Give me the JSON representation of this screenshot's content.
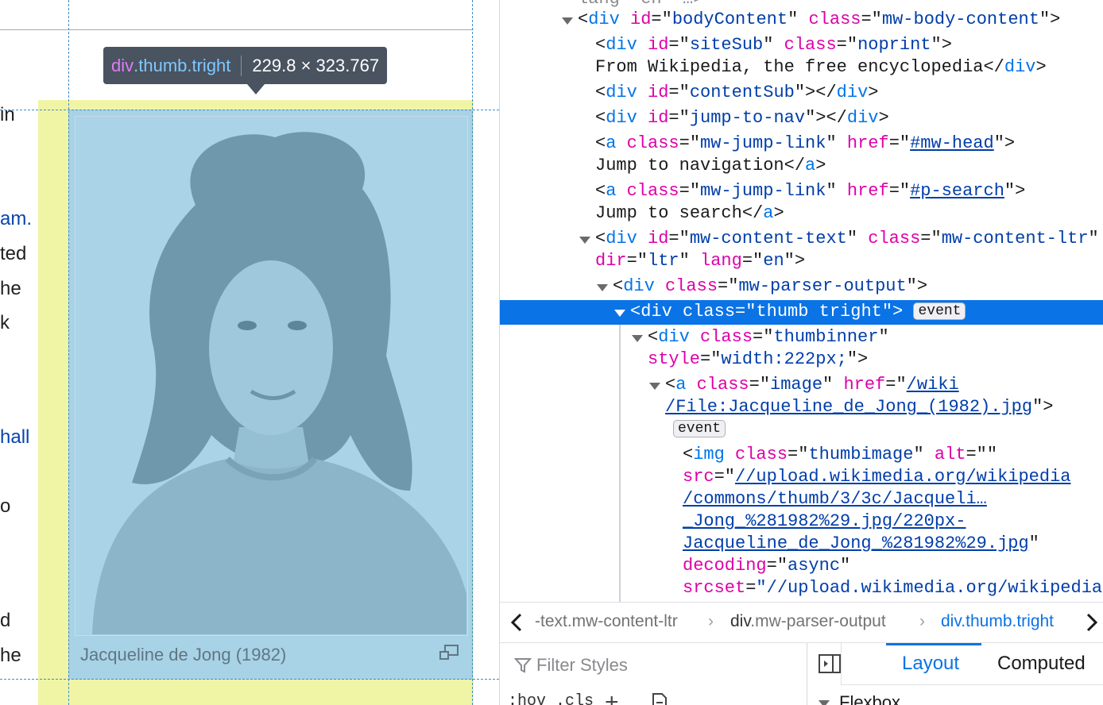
{
  "page": {
    "fragments": [
      {
        "text": "in",
        "link": false
      },
      {
        "text": "am.",
        "link": true
      },
      {
        "text": "ted",
        "link": false
      },
      {
        "text": "he",
        "link": false
      },
      {
        "text": "k",
        "link": false
      },
      {
        "text": "hall",
        "link": true
      },
      {
        "text": "o",
        "link": false
      },
      {
        "text": "d",
        "link": false
      },
      {
        "text": "he",
        "link": false
      }
    ],
    "caption": "Jacqueline de Jong (1982)",
    "highlight_colors": {
      "margin": "#f0f5a6",
      "content": "#a8d2e6"
    }
  },
  "tooltip": {
    "tag": "div",
    "classes": ".thumb.tright",
    "dimensions": "229.8 × 323.767"
  },
  "markup": {
    "top_partial": "lang=\"en\" …>",
    "lines": {
      "l1_tag": "div",
      "l1_id": "bodyContent",
      "l1_class": "mw-body-content",
      "l2_tag": "div",
      "l2_id": "siteSub",
      "l2_class": "noprint",
      "l2_text": "From Wikipedia, the free encyclopedia",
      "l3_id": "contentSub",
      "l4_id": "jump-to-nav",
      "l5_class": "mw-jump-link",
      "l5_href": "#mw-head",
      "l5_text": "Jump to navigation",
      "l6_class": "mw-jump-link",
      "l6_href": "#p-search",
      "l6_text": "Jump to search",
      "l7_id": "mw-content-text",
      "l7_class": "mw-content-ltr",
      "l7_dir": "ltr",
      "l7_lang": "en",
      "l8_class": "mw-parser-output",
      "l9_text": "<div class=\"thumb tright\">",
      "l9_badge": "event",
      "l10_class": "thumbinner",
      "l10_style": "width:222px;",
      "l11_class": "image",
      "l11_href_1": "/wiki",
      "l11_href_2": "/File:Jacqueline_de_Jong_(1982).jpg",
      "l11_badge": "event",
      "l12_class": "thumbimage",
      "l12_alt": "",
      "l12_src_1": "//upload.wikimedia.org/wikipedia",
      "l12_src_2": "/commons/thumb/3/3c/Jacqueli…",
      "l12_src_3": "_Jong_%281982%29.jpg/220px-",
      "l12_src_4": "Jacqueline_de_Jong_%281982%29.jpg",
      "l12_decoding": "async",
      "l12_srcset": "\"//upload.wikimedia.org/wikipedia"
    }
  },
  "breadcrumbs": {
    "items": [
      {
        "el": "",
        "cls": "-text.mw-content-ltr"
      },
      {
        "el": "div",
        "cls": ".mw-parser-output"
      },
      {
        "el": "div",
        "cls": ".thumb.tright"
      }
    ]
  },
  "styles_panel": {
    "filter_placeholder": "Filter Styles",
    "pseudo_buttons": ":hov .cls"
  },
  "side_panel": {
    "tabs": [
      "Layout",
      "Computed"
    ],
    "active_tab": "Layout",
    "section": "Flexbox"
  },
  "colors": {
    "selection": "#0a73e6",
    "tag": "#0074e8",
    "attr": "#dd00a9",
    "value": "#003eaa"
  }
}
